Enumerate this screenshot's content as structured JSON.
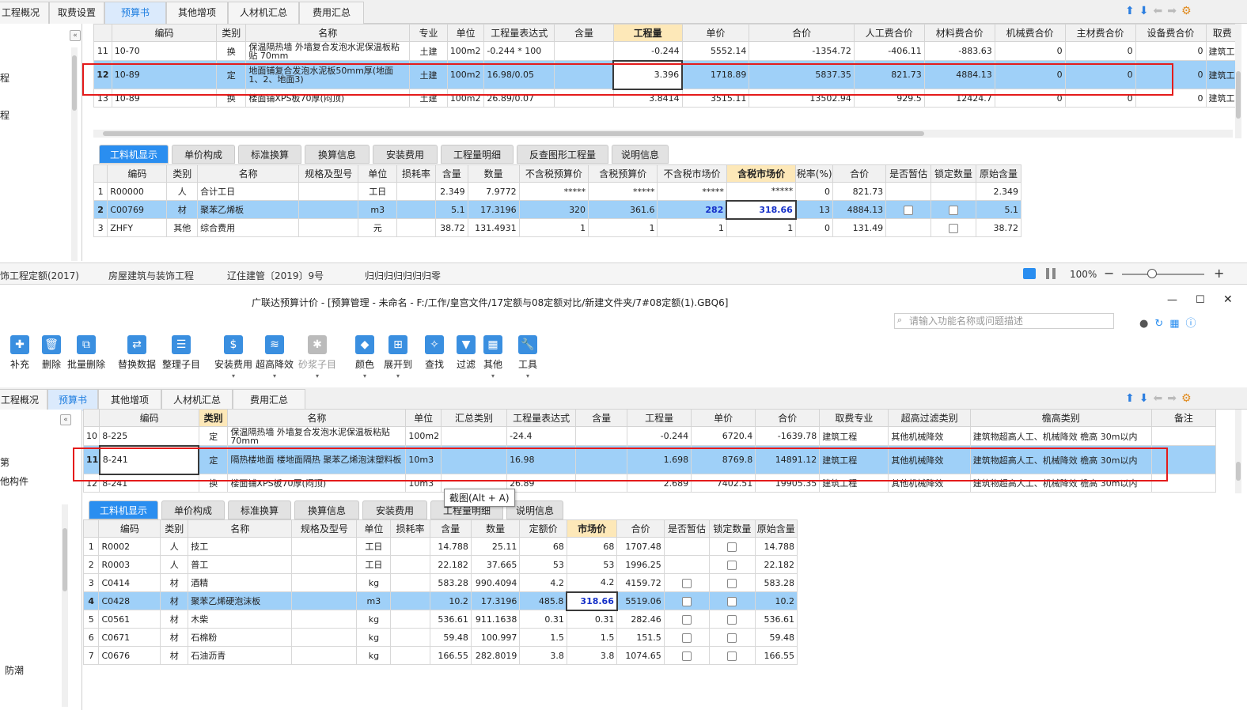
{
  "top_window": {
    "tabs": [
      "工程概况",
      "取费设置",
      "预算书",
      "其他增项",
      "人材机汇总",
      "费用汇总"
    ],
    "active_tab": "预算书",
    "left_items": [
      "程",
      "程"
    ],
    "grid": {
      "headers": [
        "编码",
        "类别",
        "名称",
        "专业",
        "单位",
        "工程量表达式",
        "含量",
        "工程量",
        "单价",
        "合价",
        "人工费合价",
        "材料费合价",
        "机械费合价",
        "主材费合价",
        "设备费合价",
        "取费"
      ],
      "rows": [
        [
          "11",
          "10-70",
          "换",
          "保温隔热墙 外墙复合发泡水泥保温板粘贴 70mm",
          "土建",
          "100m2",
          "-0.244 * 100",
          "",
          "-0.244",
          "5552.14",
          "-1354.72",
          "-406.11",
          "-883.63",
          "0",
          "0",
          "0",
          "建筑工程"
        ],
        [
          "12",
          "10-89",
          "定",
          "地面铺复合发泡水泥板50mm厚(地面1、2、地面3)",
          "土建",
          "100m2",
          "16.98/0.05",
          "",
          "3.396",
          "1718.89",
          "5837.35",
          "821.73",
          "4884.13",
          "0",
          "0",
          "0",
          "建筑工程"
        ],
        [
          "13",
          "10-89",
          "换",
          "楼面铺XPS板70厚(闷顶)",
          "土建",
          "100m2",
          "26.89/0.07",
          "",
          "3.8414",
          "3515.11",
          "13502.94",
          "929.5",
          "12424.7",
          "0",
          "0",
          "0",
          "建筑工程"
        ]
      ]
    },
    "subtabs": [
      "工料机显示",
      "单价构成",
      "标准换算",
      "换算信息",
      "安装费用",
      "工程量明细",
      "反查图形工程量",
      "说明信息"
    ],
    "detail": {
      "headers": [
        "编码",
        "类别",
        "名称",
        "规格及型号",
        "单位",
        "损耗率",
        "含量",
        "数量",
        "不含税预算价",
        "含税预算价",
        "不含税市场价",
        "含税市场价",
        "税率(%)",
        "合价",
        "是否暂估",
        "锁定数量",
        "原始含量"
      ],
      "rows": [
        [
          "1",
          "R00000",
          "人",
          "合计工日",
          "",
          "工日",
          "",
          "2.349",
          "7.9772",
          "*****",
          "*****",
          "*****",
          "*****",
          "0",
          "821.73",
          "",
          "",
          "2.349"
        ],
        [
          "2",
          "C00769",
          "材",
          "聚苯乙烯板",
          "",
          "m3",
          "",
          "5.1",
          "17.3196",
          "320",
          "361.6",
          "282",
          "318.66",
          "13",
          "4884.13",
          "cb",
          "cb",
          "5.1"
        ],
        [
          "3",
          "ZHFY",
          "其他",
          "综合费用",
          "",
          "元",
          "",
          "38.72",
          "131.4931",
          "1",
          "1",
          "1",
          "1",
          "0",
          "131.49",
          "",
          "cb",
          "38.72"
        ]
      ]
    },
    "status": [
      "饰工程定额(2017)",
      "房屋建筑与装饰工程",
      "辽住建管〔2019〕9号",
      "归归归归归归归零"
    ],
    "zoom": "100%"
  },
  "bottom_window": {
    "title": "广联达预算计价 - [预算管理 - 未命名 - F:/工作/皇宫文件/17定额与08定额对比/新建文件夹/7#08定额(1).GBQ6]",
    "search_placeholder": "请输入功能名称或问题描述",
    "toolbar": [
      "补充",
      "删除",
      "批量删除",
      "替换数据",
      "整理子目",
      "安装费用",
      "超高降效",
      "砂浆子目",
      "颜色",
      "展开到",
      "查找",
      "过滤",
      "其他",
      "工具"
    ],
    "tabs": [
      "工程概况",
      "预算书",
      "其他增项",
      "人材机汇总",
      "费用汇总"
    ],
    "active_tab": "预算书",
    "left_items": [
      "第",
      "他构件",
      "防潮"
    ],
    "grid": {
      "headers": [
        "编码",
        "类别",
        "名称",
        "单位",
        "汇总类别",
        "工程量表达式",
        "含量",
        "工程量",
        "单价",
        "合价",
        "取费专业",
        "超高过滤类别",
        "檐高类别",
        "备注"
      ],
      "rows": [
        [
          "10",
          "8-225",
          "定",
          "保温隔热墙 外墙复合发泡水泥保温板粘贴 70mm",
          "100m2",
          "",
          "-24.4",
          "",
          "-0.244",
          "6720.4",
          "-1639.78",
          "建筑工程",
          "其他机械降效",
          "建筑物超高人工、机械降效 檐高 30m以内",
          ""
        ],
        [
          "11",
          "8-241",
          "定",
          "隔热楼地面 楼地面隔热 聚苯乙烯泡沫塑料板",
          "10m3",
          "",
          "16.98",
          "",
          "1.698",
          "8769.8",
          "14891.12",
          "建筑工程",
          "其他机械降效",
          "建筑物超高人工、机械降效 檐高 30m以内",
          ""
        ],
        [
          "12",
          "8-241",
          "换",
          "楼面铺XPS板70厚(闷顶)",
          "10m3",
          "",
          "26.89",
          "",
          "2.689",
          "7402.51",
          "19905.35",
          "建筑工程",
          "其他机械降效",
          "建筑物超高人工、机械降效 檐高 30m以内",
          ""
        ]
      ]
    },
    "tooltip": "截图(Alt + A)",
    "subtabs": [
      "工料机显示",
      "单价构成",
      "标准换算",
      "换算信息",
      "安装费用",
      "工程量明细",
      "说明信息"
    ],
    "detail": {
      "headers": [
        "编码",
        "类别",
        "名称",
        "规格及型号",
        "单位",
        "损耗率",
        "含量",
        "数量",
        "定额价",
        "市场价",
        "合价",
        "是否暂估",
        "锁定数量",
        "原始含量"
      ],
      "rows": [
        [
          "1",
          "R0002",
          "人",
          "技工",
          "",
          "工日",
          "",
          "14.788",
          "25.11",
          "68",
          "68",
          "1707.48",
          "",
          "cb",
          "14.788"
        ],
        [
          "2",
          "R0003",
          "人",
          "普工",
          "",
          "工日",
          "",
          "22.182",
          "37.665",
          "53",
          "53",
          "1996.25",
          "",
          "cb",
          "22.182"
        ],
        [
          "3",
          "C0414",
          "材",
          "酒精",
          "",
          "kg",
          "",
          "583.28",
          "990.4094",
          "4.2",
          "4.2",
          "4159.72",
          "cb",
          "cb",
          "583.28"
        ],
        [
          "4",
          "C0428",
          "材",
          "聚苯乙烯硬泡沫板",
          "",
          "m3",
          "",
          "10.2",
          "17.3196",
          "485.8",
          "318.66",
          "5519.06",
          "cb",
          "cb",
          "10.2"
        ],
        [
          "5",
          "C0561",
          "材",
          "木柴",
          "",
          "kg",
          "",
          "536.61",
          "911.1638",
          "0.31",
          "0.31",
          "282.46",
          "cb",
          "cb",
          "536.61"
        ],
        [
          "6",
          "C0671",
          "材",
          "石棉粉",
          "",
          "kg",
          "",
          "59.48",
          "100.997",
          "1.5",
          "1.5",
          "151.5",
          "cb",
          "cb",
          "59.48"
        ],
        [
          "7",
          "C0676",
          "材",
          "石油沥青",
          "",
          "kg",
          "",
          "166.55",
          "282.8019",
          "3.8",
          "3.8",
          "1074.65",
          "cb",
          "cb",
          "166.55"
        ]
      ]
    }
  },
  "colors": {
    "selected_row": "#9fd0f8",
    "active_subtab": "#2a8ef0",
    "highlight_header": "#fde8b8",
    "red_box": "#e41b1b",
    "accent_text": "#1530c8"
  }
}
